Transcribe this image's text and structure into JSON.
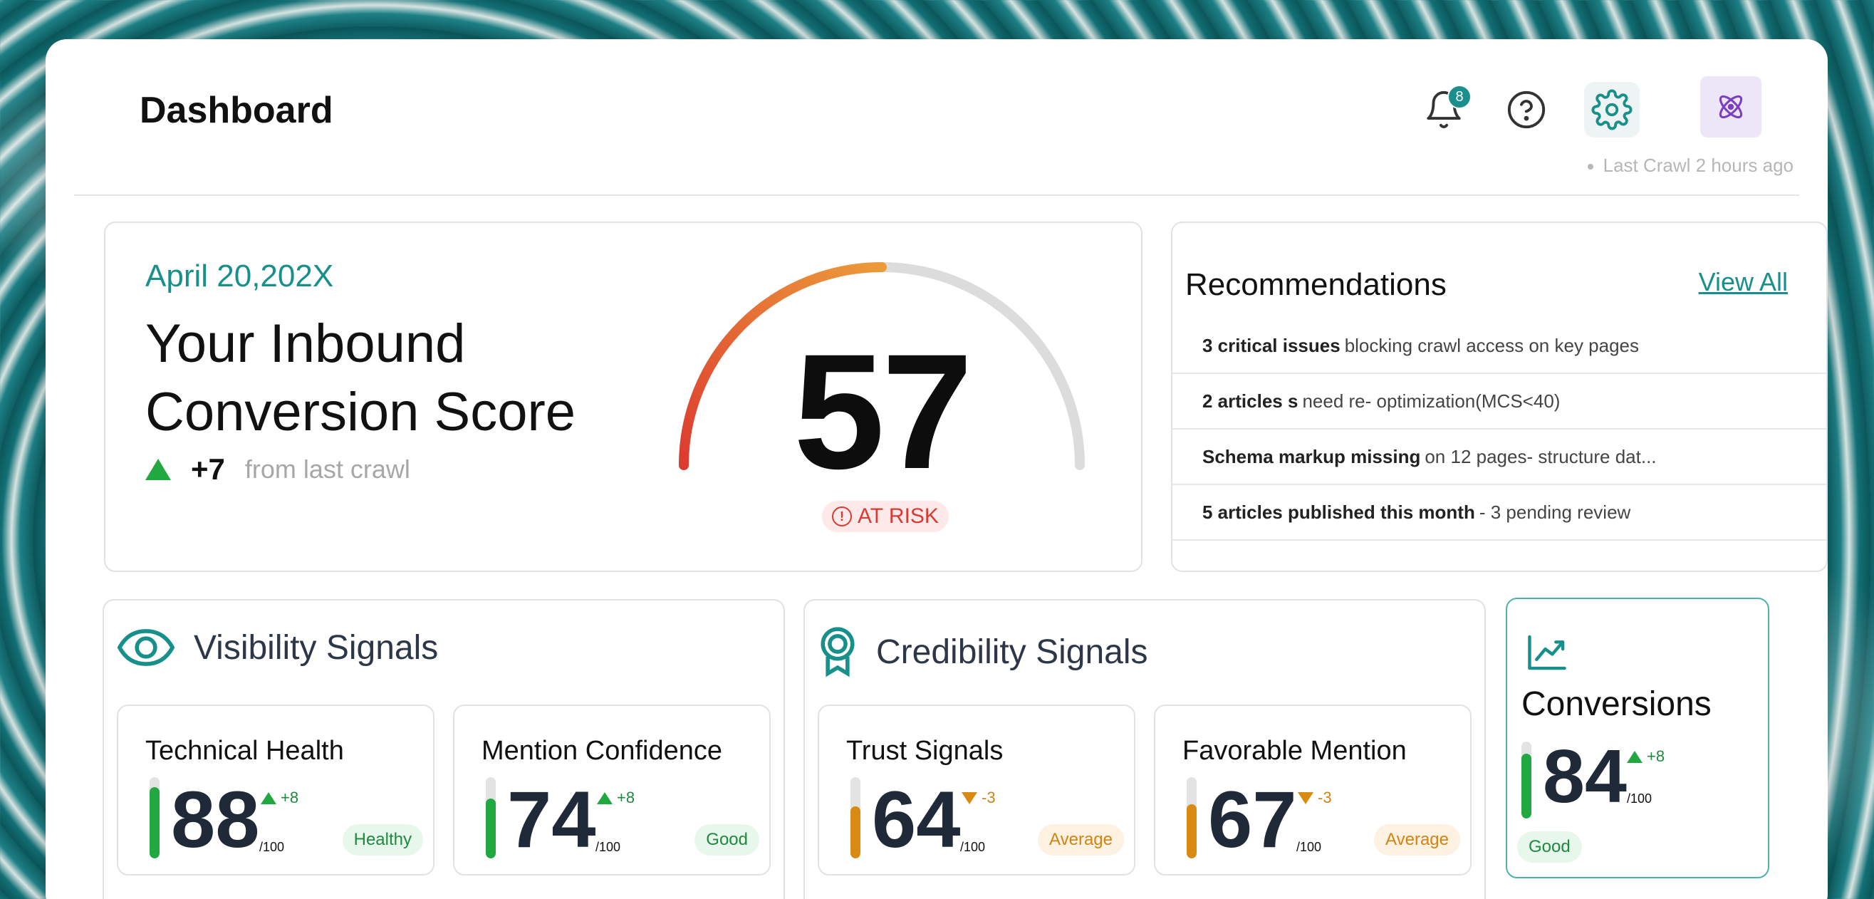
{
  "header": {
    "title": "Dashboard",
    "notification_count": "8",
    "last_crawl": "Last Crawl 2 hours ago",
    "icons": [
      "bell-icon",
      "help-icon",
      "gear-icon",
      "atom-icon"
    ]
  },
  "score": {
    "date": "April 20,202X",
    "title": "Your Inbound Conversion Score",
    "delta": "+7",
    "delta_text": "from last crawl",
    "value": "57",
    "gauge_fraction": 0.5,
    "status": "AT RISK"
  },
  "recommendations": {
    "title": "Recommendations",
    "view_all": "View All",
    "items": [
      {
        "bold": "3 critical issues",
        "text": "blocking crawl access on key pages"
      },
      {
        "bold": "2 articles s",
        "text": "need re- optimization(MCS<40)"
      },
      {
        "bold": "Schema markup missing",
        "text": "on 12 pages- structure dat..."
      },
      {
        "bold": "5 articles published this month",
        "text": "- 3 pending review"
      }
    ]
  },
  "visibility": {
    "title": "Visibility Signals",
    "metrics": [
      {
        "name": "Technical Health",
        "value": "88",
        "out_of": "/100",
        "delta": "+8",
        "direction": "up",
        "badge": "Healthy",
        "level": 0.88
      },
      {
        "name": "Mention Confidence",
        "value": "74",
        "out_of": "/100",
        "delta": "+8",
        "direction": "up",
        "badge": "Good",
        "level": 0.74
      }
    ]
  },
  "credibility": {
    "title": "Credibility Signals",
    "metrics": [
      {
        "name": "Trust Signals",
        "value": "64",
        "out_of": "/100",
        "delta": "-3",
        "direction": "down",
        "badge": "Average",
        "level": 0.64
      },
      {
        "name": "Favorable Mention",
        "value": "67",
        "out_of": "/100",
        "delta": "-3",
        "direction": "down",
        "badge": "Average",
        "level": 0.67
      }
    ]
  },
  "conversions": {
    "title": "Conversions",
    "value": "84",
    "out_of": "/100",
    "delta": "+8",
    "direction": "up",
    "badge": "Good",
    "level": 0.84
  },
  "colors": {
    "accent": "#17908b",
    "good": "#22a840",
    "average": "#d98a12",
    "risk": "#d93a32"
  }
}
